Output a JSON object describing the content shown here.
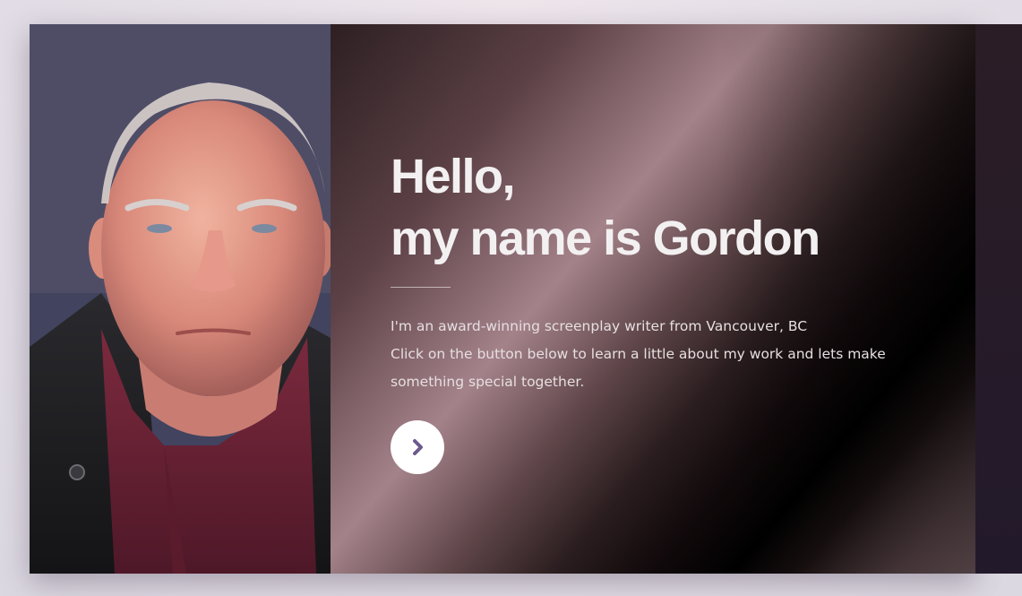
{
  "hero": {
    "title_line_1": "Hello,",
    "title_line_2": "my name is Gordon",
    "description_line_1": "I'm an award-winning screenplay writer from Vancouver, BC",
    "description_line_2": "Click on the button below to learn a little about my work and lets make",
    "description_line_3": "something special together.",
    "next_button_icon": "chevron-right-icon",
    "portrait_image": "portrait-photo"
  },
  "colors": {
    "button_background": "#ffffff",
    "chevron": "#6b5a8e",
    "title_text": "#f3f0f1",
    "body_text": "#e6dfe1"
  }
}
